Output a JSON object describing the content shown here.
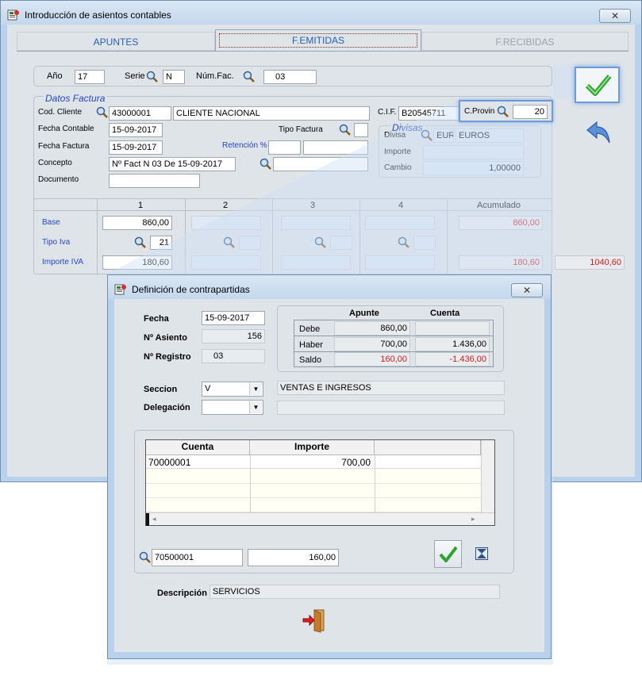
{
  "main_window": {
    "title": "Introducción de asientos contables",
    "close": "✕",
    "tabs": [
      "APUNTES",
      "F.EMITIDAS",
      "F.RECIBIDAS"
    ],
    "top": {
      "year_label": "Año",
      "year": "17",
      "serie_label": "Serie",
      "serie": "N",
      "numfac_label": "Núm.Fac.",
      "numfac": "03"
    },
    "datos": {
      "title": "Datos Factura",
      "cod_cliente_label": "Cod. Cliente",
      "cod_cliente": "43000001",
      "cliente_nombre": "CLIENTE NACIONAL",
      "cif_label": "C.I.F.",
      "cif": "B20545711",
      "cprovin_label": "C.Provin",
      "cprovin": "20",
      "fecha_contable_label": "Fecha Contable",
      "fecha_contable": "15-09-2017",
      "tipo_factura_label": "Tipo Factura",
      "fecha_factura_label": "Fecha Factura",
      "fecha_factura": "15-09-2017",
      "retencion_label": "Retención %",
      "concepto_label": "Concepto",
      "concepto": "Nº Fact N 03 De 15-09-2017",
      "documento_label": "Documento"
    },
    "divisas": {
      "title": "Divisas",
      "divisa_label": "Divisa",
      "divisa_code": "EUR",
      "divisa_name": "EUROS",
      "importe_label": "Importe",
      "cambio_label": "Cambio",
      "cambio": "1,00000"
    },
    "iva_grid": {
      "columns": [
        "1",
        "2",
        "3",
        "4",
        "Acumulado"
      ],
      "base_label": "Base",
      "base_1": "860,00",
      "base_acum": "860,00",
      "tipo_label": "Tipo Iva",
      "tipo_1": "21",
      "importe_label": "Importe IVA",
      "importe_1": "180,60",
      "importe_acum": "180,60",
      "total": "1040,60"
    }
  },
  "dialog": {
    "title": "Definición de contrapartidas",
    "close": "✕",
    "fecha_label": "Fecha",
    "fecha": "15-09-2017",
    "asiento_label": "Nº Asiento",
    "asiento": "156",
    "registro_label": "Nº Registro",
    "registro": "03",
    "summary": {
      "headers": [
        "Apunte",
        "Cuenta"
      ],
      "rows": [
        {
          "label": "Debe",
          "apunte": "860,00",
          "cuenta": ""
        },
        {
          "label": "Haber",
          "apunte": "700,00",
          "cuenta": "1.436,00"
        },
        {
          "label": "Saldo",
          "apunte": "160,00",
          "cuenta": "-1.436,00"
        }
      ]
    },
    "seccion_label": "Seccion",
    "seccion": "V",
    "seccion_desc": "VENTAS  E INGRESOS",
    "delegacion_label": "Delegación",
    "grid": {
      "headers": [
        "Cuenta",
        "Importe"
      ],
      "rows": [
        {
          "cuenta": "70000001",
          "importe": "700,00"
        }
      ]
    },
    "entry_cuenta": "70500001",
    "entry_importe": "160,00",
    "descripcion_label": "Descripción",
    "descripcion": "SERVICIOS"
  }
}
